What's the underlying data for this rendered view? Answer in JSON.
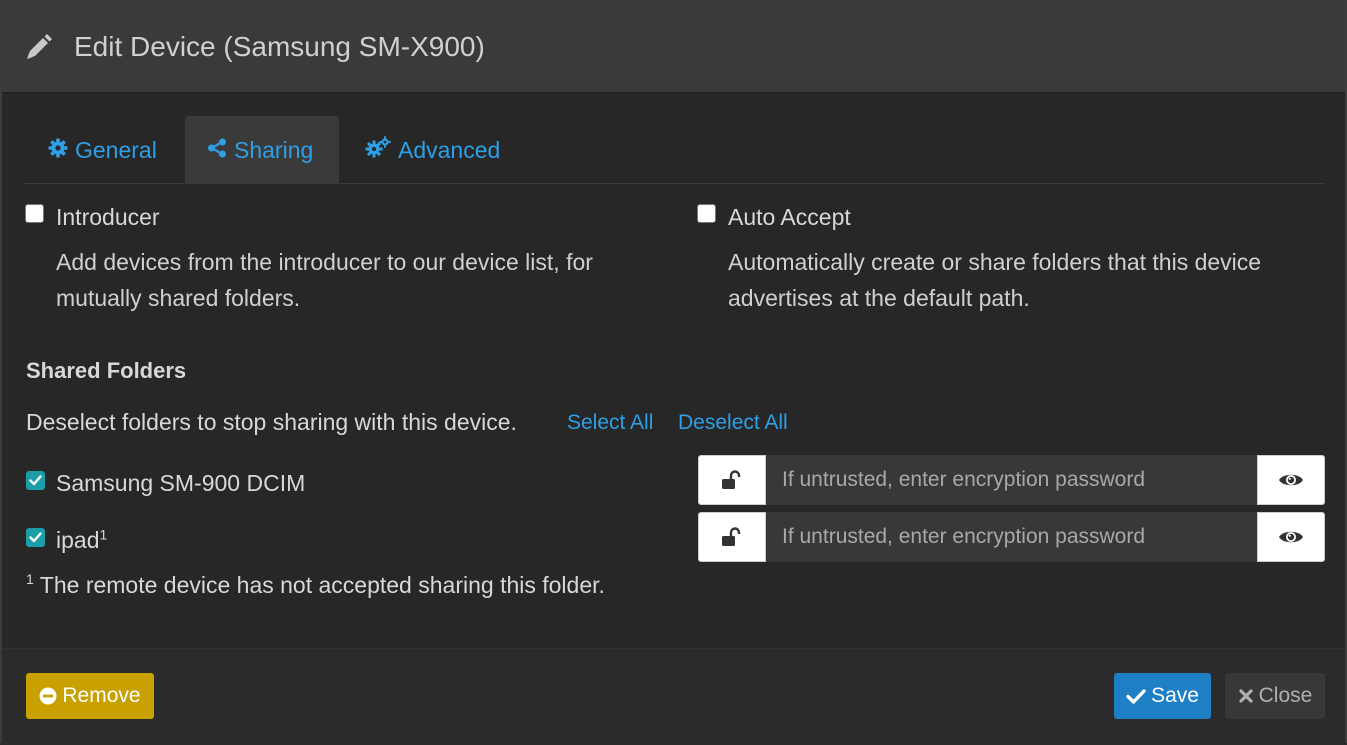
{
  "header": {
    "title": "Edit Device (Samsung SM-X900)",
    "icon": "pencil-icon"
  },
  "tabs": [
    {
      "label": "General",
      "icon": "gear-icon",
      "active": false
    },
    {
      "label": "Sharing",
      "icon": "share-icon",
      "active": true
    },
    {
      "label": "Advanced",
      "icon": "gears-icon",
      "active": false
    }
  ],
  "options": {
    "introducer": {
      "label": "Introducer",
      "checked": false,
      "help": "Add devices from the introducer to our device list, for mutually shared folders."
    },
    "auto_accept": {
      "label": "Auto Accept",
      "checked": false,
      "help": "Automatically create or share folders that this device advertises at the default path."
    }
  },
  "shared_folders": {
    "title": "Shared Folders",
    "instructions": "Deselect folders to stop sharing with this device.",
    "select_all": "Select All",
    "deselect_all": "Deselect All",
    "folders": [
      {
        "name": "Samsung SM-900 DCIM",
        "checked": true,
        "footnote": "",
        "password_placeholder": "If untrusted, enter encryption password"
      },
      {
        "name": "ipad",
        "checked": true,
        "footnote": "1",
        "password_placeholder": "If untrusted, enter encryption password"
      }
    ],
    "footnote_marker": "1",
    "footnote_text": "The remote device has not accepted sharing this folder."
  },
  "footer": {
    "remove_label": "Remove",
    "save_label": "Save",
    "close_label": "Close"
  },
  "colors": {
    "accent": "#2e9fe6",
    "save": "#1f7fc4",
    "remove": "#c8a100",
    "checkbox_checked": "#1c9ea8"
  }
}
